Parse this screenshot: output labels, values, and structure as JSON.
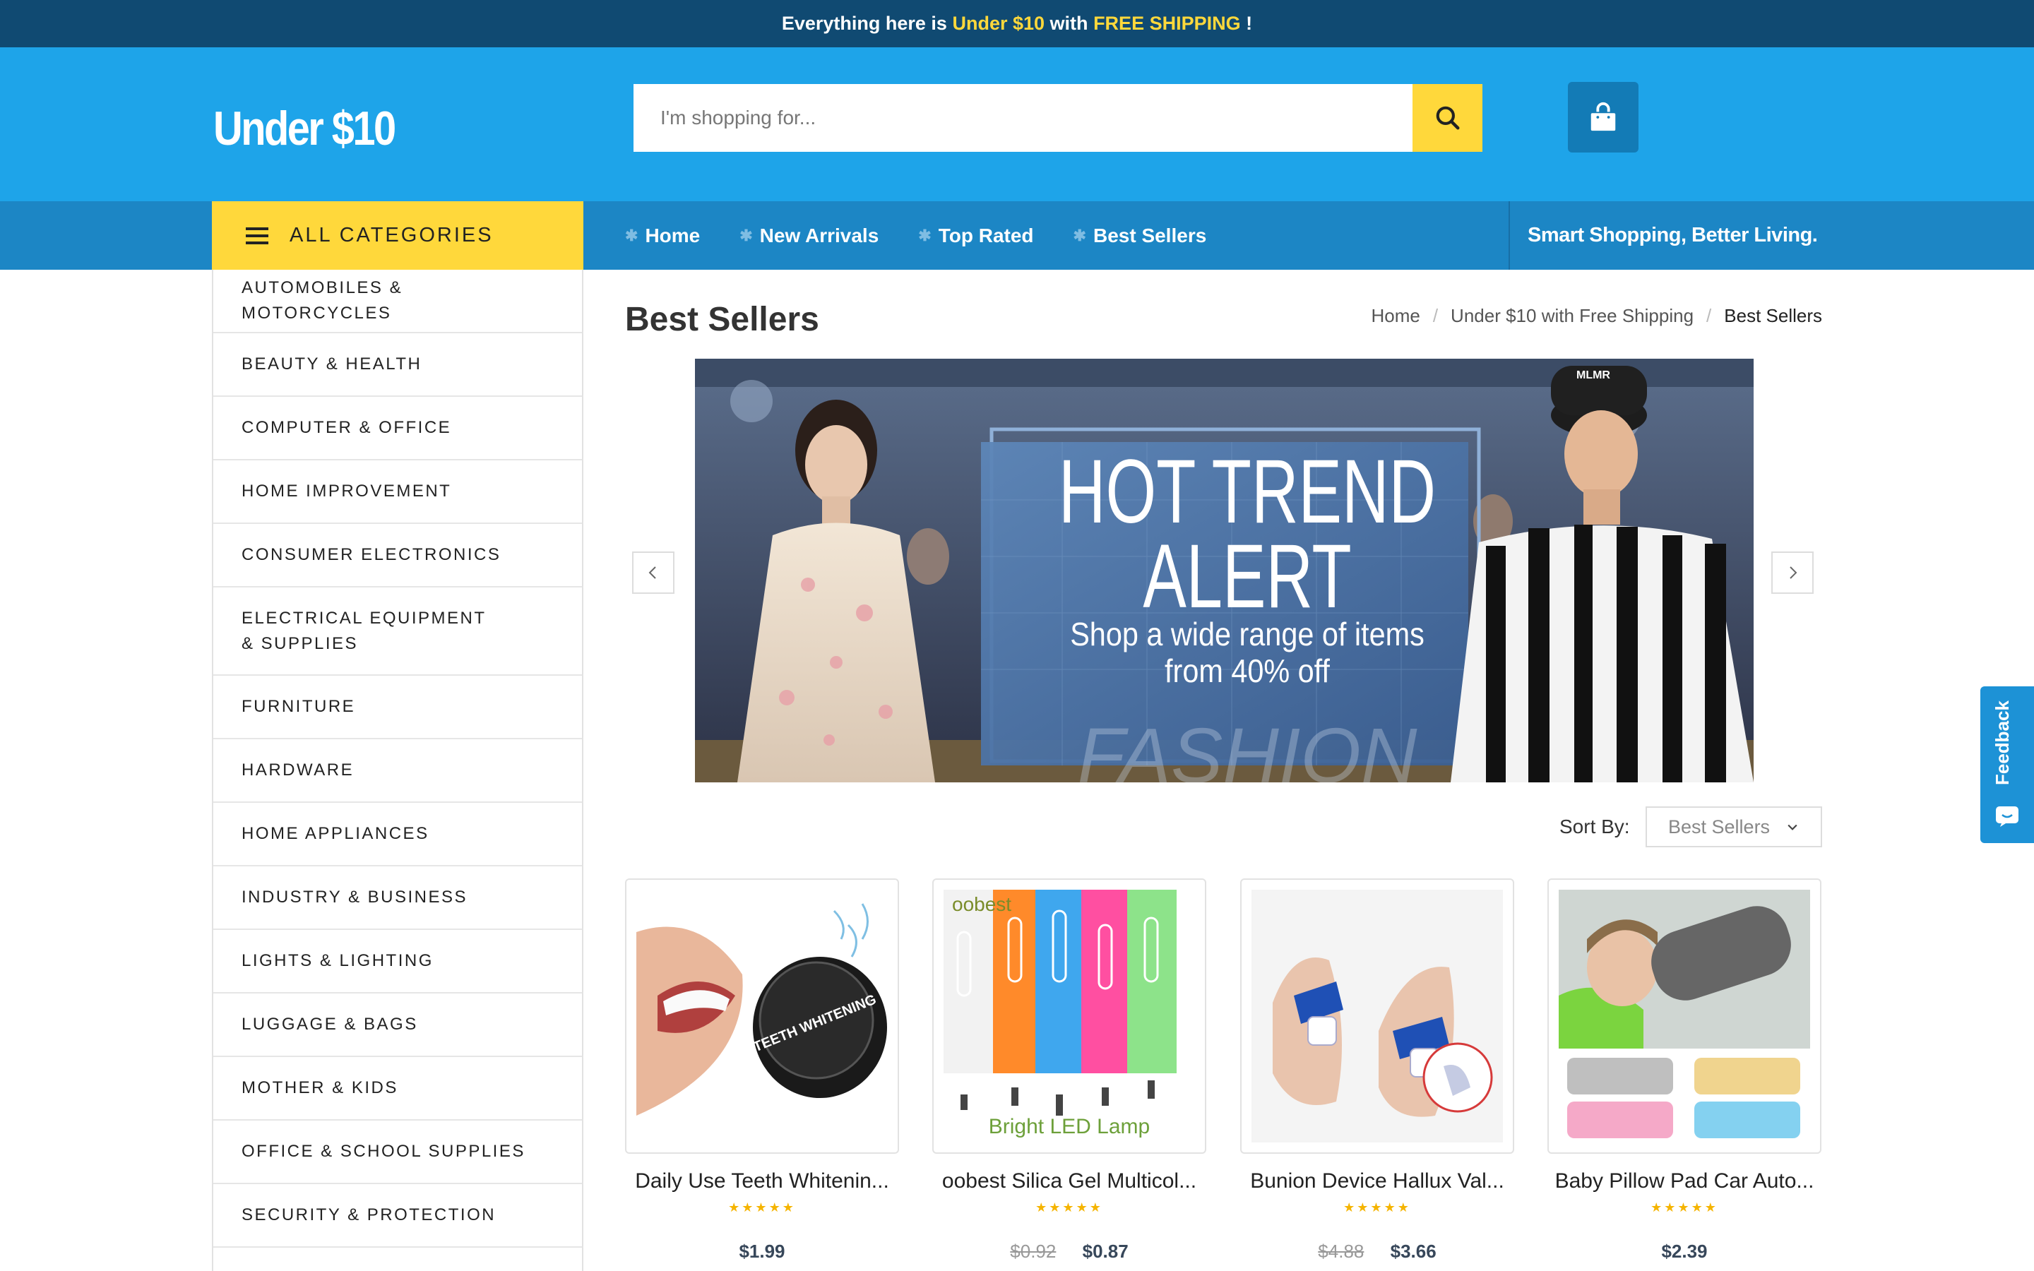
{
  "topbar": {
    "pre": "Everything here is",
    "hl1": "Under $10",
    "mid": "with",
    "hl2": "FREE SHIPPING",
    "post": "!"
  },
  "header": {
    "logo": "Under $10",
    "search_placeholder": "I'm shopping for...",
    "search_icon": "search-icon",
    "cart_icon": "shopping-bag-icon"
  },
  "nav": {
    "all_categories": "ALL CATEGORIES",
    "links": [
      "Home",
      "New Arrivals",
      "Top Rated",
      "Best Sellers"
    ],
    "tagline": "Smart Shopping, Better Living."
  },
  "categories": [
    "AUTOMOBILES & MOTORCYCLES",
    "BEAUTY & HEALTH",
    "COMPUTER & OFFICE",
    "HOME IMPROVEMENT",
    "CONSUMER ELECTRONICS",
    "ELECTRICAL EQUIPMENT & SUPPLIES",
    "FURNITURE",
    "HARDWARE",
    "HOME APPLIANCES",
    "INDUSTRY & BUSINESS",
    "LIGHTS & LIGHTING",
    "LUGGAGE & BAGS",
    "MOTHER & KIDS",
    "OFFICE & SCHOOL SUPPLIES",
    "SECURITY & PROTECTION"
  ],
  "main": {
    "title": "Best Sellers",
    "breadcrumb": [
      "Home",
      "Under $10 with Free Shipping",
      "Best Sellers"
    ],
    "banner": {
      "line1": "HOT TREND",
      "line2": "ALERT",
      "line3": "Shop a wide range of items",
      "line4": "from 40% off",
      "bg_word": "FASHION",
      "cap_text": "MLMR"
    },
    "sort_label": "Sort By:",
    "sort_value": "Best Sellers"
  },
  "products": [
    {
      "name": "Daily Use Teeth Whitenin...",
      "stars": "★★★★★",
      "old_price": "",
      "price": "$1.99",
      "img_text": "TEETH WHITENING"
    },
    {
      "name": "oobest Silica Gel Multicol...",
      "stars": "★★★★★",
      "old_price": "$0.92",
      "price": "$0.87",
      "img_text": "Bright  LED Lamp",
      "img_brand": "oobest"
    },
    {
      "name": "Bunion Device Hallux Val...",
      "stars": "★★★★★",
      "old_price": "$4.88",
      "price": "$3.66"
    },
    {
      "name": "Baby Pillow Pad Car Auto...",
      "stars": "★★★★★",
      "old_price": "",
      "price": "$2.39"
    }
  ],
  "feedback": {
    "label": "Feedback"
  }
}
